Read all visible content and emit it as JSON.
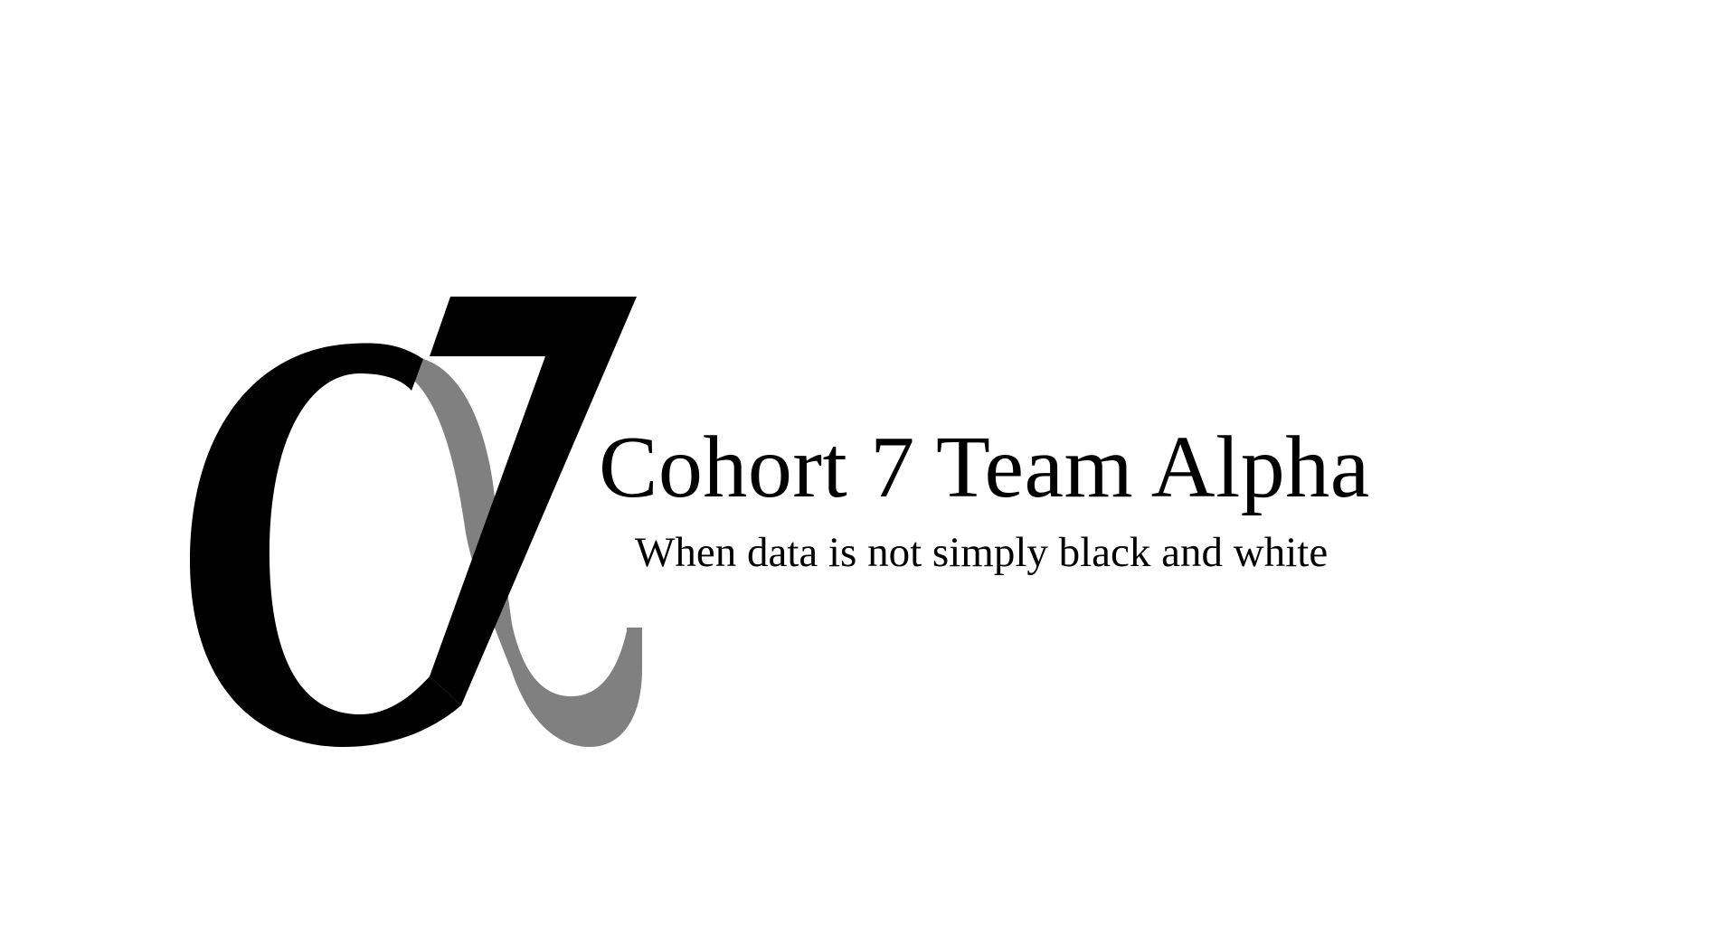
{
  "logo": {
    "team_name": "Cohort 7 Team Alpha",
    "tagline": "When data is not simply black and white",
    "mark_icon": "alpha-symbol-icon",
    "colors": {
      "background": "#ffffff",
      "primary": "#000000",
      "secondary": "#808080"
    }
  }
}
